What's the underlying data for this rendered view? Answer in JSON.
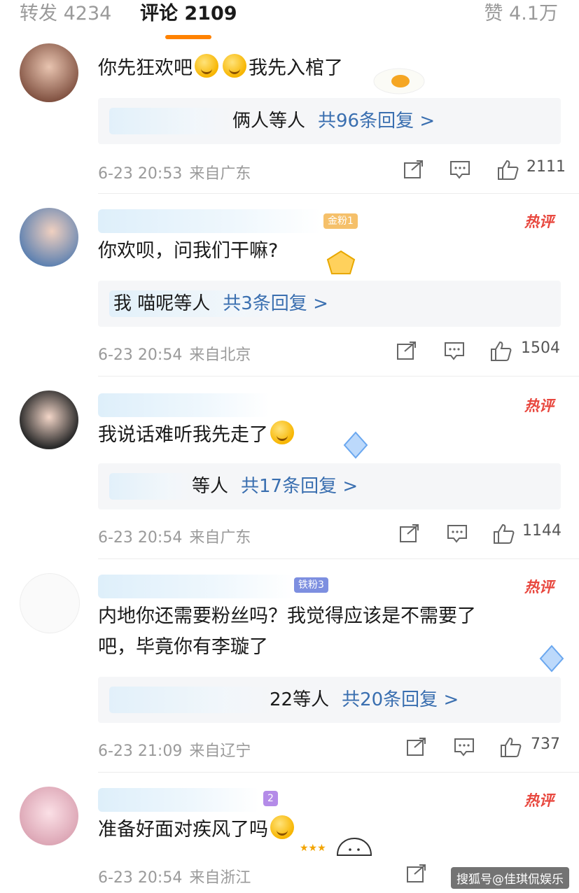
{
  "tabs": {
    "repost": "转发 4234",
    "comments": "评论 2109",
    "likes": "赞 4.1万"
  },
  "comments": [
    {
      "text": "你先狂欢吧",
      "text_after_emoji": "我先入棺了",
      "replies_who": "俩人等人",
      "replies_count": "共96条回复 >",
      "time": "6-23 20:53",
      "location": "来自广东",
      "likes": "2111",
      "hot": false
    },
    {
      "badge": "金粉1",
      "hot_label": "热评",
      "text": "你欢呗，问我们干嘛?",
      "replies_who": "我 喵呢等人",
      "replies_count": "共3条回复 >",
      "time": "6-23 20:54",
      "location": "来自北京",
      "likes": "1504",
      "hot": true
    },
    {
      "hot_label": "热评",
      "text": "我说话难听我先走了",
      "replies_who": "等人",
      "replies_count": "共17条回复 >",
      "time": "6-23 20:54",
      "location": "来自广东",
      "likes": "1144",
      "hot": true
    },
    {
      "badge": "铁粉3",
      "hot_label": "热评",
      "text_line1": "内地你还需要粉丝吗？我觉得应该是不需要了",
      "text_line2": "吧，毕竟你有李璇了",
      "replies_who": "22等人",
      "replies_count": "共20条回复 >",
      "time": "6-23 21:09",
      "location": "来自辽宁",
      "likes": "737",
      "hot": true
    },
    {
      "badge": "2",
      "hot_label": "热评",
      "text": "准备好面对疾风了吗",
      "time": "6-23 20:54",
      "location": "来自浙江",
      "hot": true
    }
  ],
  "watermark": "搜狐号@佳琪侃娱乐",
  "colors": {
    "accent": "#ff8200",
    "hot": "#e8473e",
    "link": "#3a6fb0",
    "meta": "#9a9a9a",
    "reply_bg": "#f5f6f8"
  }
}
